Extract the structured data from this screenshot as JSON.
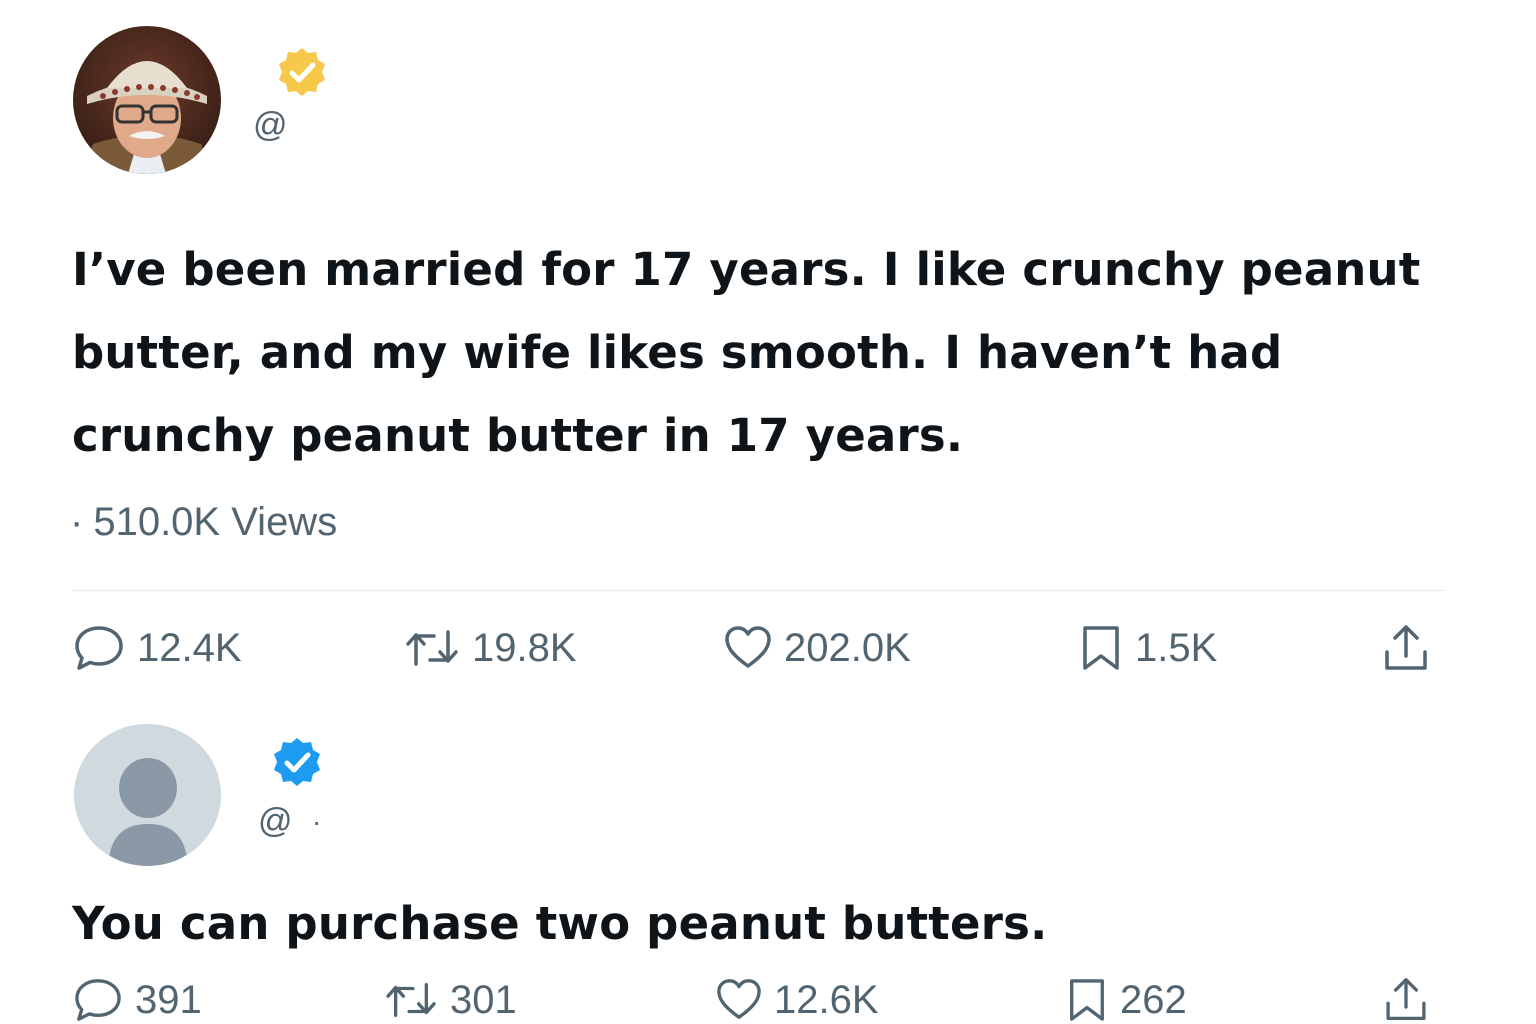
{
  "tweet1": {
    "avatar_icon": "user-photo-avatar",
    "verified_color": "#f4c430",
    "handle": "@",
    "text": "I’ve been married for 17 years. I like crunchy peanut butter, and my wife likes smooth. I haven’t had crunchy peanut butter in 17 years.",
    "views_sep": "·",
    "views": "510.0K Views",
    "actions": {
      "reply": "12.4K",
      "retweet": "19.8K",
      "like": "202.0K",
      "bookmark": "1.5K"
    }
  },
  "tweet2": {
    "avatar_icon": "default-avatar",
    "verified_color": "#1d9bf0",
    "handle": "@",
    "handle_sep": "·",
    "text": "You can purchase two peanut butters.",
    "actions": {
      "reply": "391",
      "retweet": "301",
      "like": "12.6K",
      "bookmark": "262"
    }
  },
  "colors": {
    "text": "#0f1419",
    "muted": "#536471",
    "divider": "#e7ebee"
  }
}
